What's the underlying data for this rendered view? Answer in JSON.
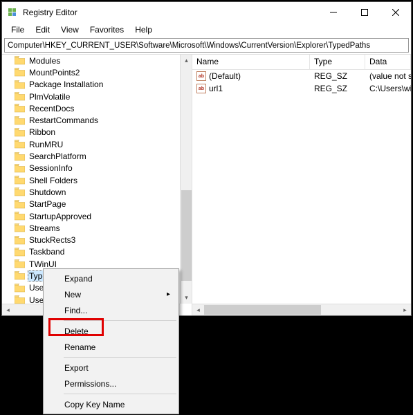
{
  "window": {
    "title": "Registry Editor"
  },
  "menubar": {
    "file": "File",
    "edit": "Edit",
    "view": "View",
    "favorites": "Favorites",
    "help": "Help"
  },
  "addressbar": {
    "path": "Computer\\HKEY_CURRENT_USER\\Software\\Microsoft\\Windows\\CurrentVersion\\Explorer\\TypedPaths"
  },
  "tree": {
    "items": [
      {
        "label": "Modules"
      },
      {
        "label": "MountPoints2"
      },
      {
        "label": "Package Installation"
      },
      {
        "label": "PlmVolatile"
      },
      {
        "label": "RecentDocs"
      },
      {
        "label": "RestartCommands"
      },
      {
        "label": "Ribbon"
      },
      {
        "label": "RunMRU"
      },
      {
        "label": "SearchPlatform"
      },
      {
        "label": "SessionInfo"
      },
      {
        "label": "Shell Folders"
      },
      {
        "label": "Shutdown"
      },
      {
        "label": "StartPage"
      },
      {
        "label": "StartupApproved"
      },
      {
        "label": "Streams"
      },
      {
        "label": "StuckRects3"
      },
      {
        "label": "Taskband"
      },
      {
        "label": "TWinUI"
      },
      {
        "label": "TypedPaths",
        "selected": true
      },
      {
        "label": "User Shell Folders"
      },
      {
        "label": "UserAssist"
      }
    ]
  },
  "list": {
    "headers": {
      "name": "Name",
      "type": "Type",
      "data": "Data"
    },
    "rows": [
      {
        "name": "(Default)",
        "type": "REG_SZ",
        "data": "(value not set)"
      },
      {
        "name": "url1",
        "type": "REG_SZ",
        "data": "C:\\Users\\winaero"
      }
    ]
  },
  "context_menu": {
    "expand": "Expand",
    "new": "New",
    "find": "Find...",
    "delete": "Delete",
    "rename": "Rename",
    "export": "Export",
    "permissions": "Permissions...",
    "copy_key_name": "Copy Key Name"
  }
}
